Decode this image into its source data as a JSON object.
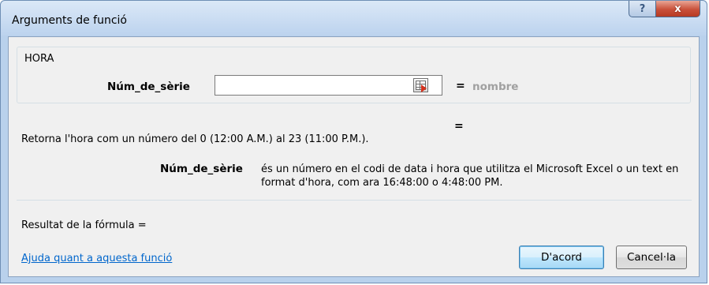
{
  "window": {
    "title": "Arguments de funció",
    "help_button_label": "?",
    "close_button_label": "x"
  },
  "function_group": {
    "name": "HORA",
    "argument_label": "Núm_de_sèrie",
    "argument_value": "",
    "argument_equals": "=",
    "argument_result": "nombre"
  },
  "result_equals": "=",
  "function_description": "Retorna l'hora com un número del 0 (12:00 A.M.) al 23 (11:00 P.M.).",
  "argument_description": {
    "name": "Núm_de_sèrie",
    "text": "és un número en el codi de data i hora que utilitza el Microsoft Excel o un text en format d'hora, com ara 16:48:00 o 4:48:00 PM."
  },
  "formula_result_label": "Resultat de la fórmula =",
  "help_link": "Ajuda quant a aquesta funció",
  "buttons": {
    "ok": "D'acord",
    "cancel": "Cancel·la"
  },
  "colors": {
    "window_frame": "#b9d1ec",
    "close_button": "#c9503a",
    "link": "#0066cc",
    "placeholder_result": "#a0a0a0"
  }
}
